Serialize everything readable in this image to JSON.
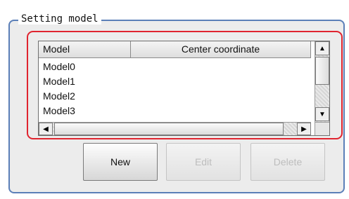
{
  "group": {
    "title": "Setting model"
  },
  "list": {
    "columns": [
      "Model",
      "Center coordinate"
    ],
    "rows": [
      {
        "model": "Model0",
        "center": ""
      },
      {
        "model": "Model1",
        "center": ""
      },
      {
        "model": "Model2",
        "center": ""
      },
      {
        "model": "Model3",
        "center": ""
      }
    ]
  },
  "buttons": {
    "new_label": "New",
    "edit_label": "Edit",
    "delete_label": "Delete"
  },
  "icons": {
    "scroll_up": "arrow-up-icon",
    "scroll_down": "arrow-down-icon",
    "scroll_left": "arrow-left-icon",
    "scroll_right": "arrow-right-icon"
  },
  "colors": {
    "group_border": "#5b7fb8",
    "highlight_border": "#e0242f"
  }
}
